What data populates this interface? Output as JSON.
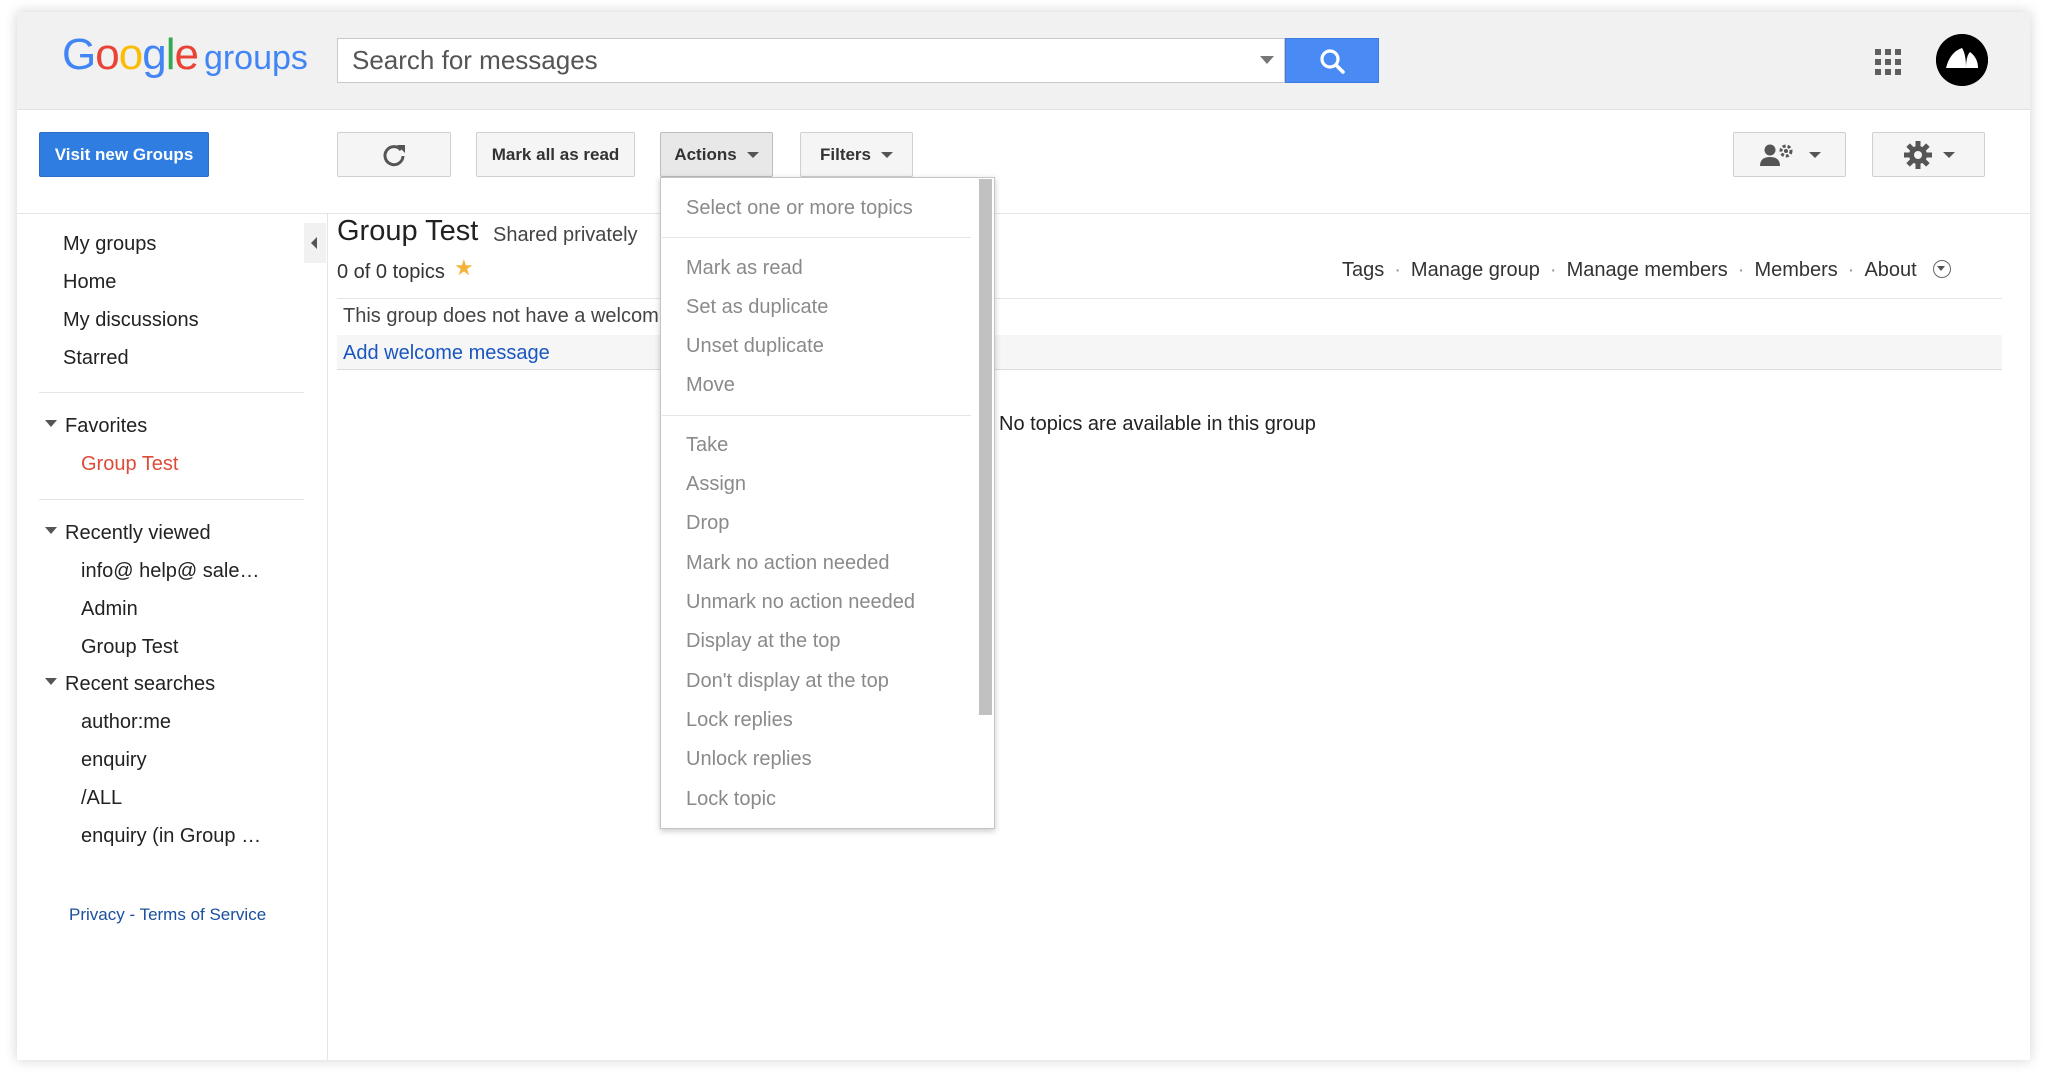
{
  "header": {
    "logo_word": "Google",
    "logo_suffix": "groups",
    "search_placeholder": "Search for messages"
  },
  "toolbar": {
    "visit_new_groups": "Visit new Groups",
    "mark_all_read": "Mark all as read",
    "actions": "Actions",
    "filters": "Filters"
  },
  "sidebar": {
    "nav": [
      "My groups",
      "Home",
      "My discussions",
      "Starred"
    ],
    "favorites": {
      "title": "Favorites",
      "items": [
        "Group Test"
      ]
    },
    "recently_viewed": {
      "title": "Recently viewed",
      "items": [
        "info@ help@ sale…",
        "Admin",
        "Group Test"
      ]
    },
    "recent_searches": {
      "title": "Recent searches",
      "items": [
        "author:me",
        "enquiry",
        "/ALL",
        "enquiry (in Group …"
      ]
    },
    "footer": {
      "privacy": "Privacy",
      "dash": "-",
      "terms": "Terms of Service"
    }
  },
  "main": {
    "group_title": "Group Test",
    "shared": "Shared privately",
    "topics_count": "0 of 0 topics",
    "links": [
      "Tags",
      "Manage group",
      "Manage members",
      "Members",
      "About"
    ],
    "link_separator": "·",
    "welcome_text": "This group does not have a welcom",
    "add_welcome": "Add welcome message",
    "no_topics": "No topics are available in this group"
  },
  "actions_menu": {
    "header": "Select one or more topics",
    "group1": [
      "Mark as read",
      "Set as duplicate",
      "Unset duplicate",
      "Move"
    ],
    "group2": [
      "Take",
      "Assign",
      "Drop",
      "Mark no action needed",
      "Unmark no action needed",
      "Display at the top",
      "Don't display at the top",
      "Lock replies",
      "Unlock replies",
      "Lock topic"
    ]
  },
  "icons": {
    "search": "search-icon",
    "refresh": "refresh-icon",
    "apps": "apps-grid-icon",
    "avatar": "avatar",
    "people_settings": "people-settings-icon",
    "settings": "gear-icon",
    "star": "star-icon"
  },
  "colors": {
    "accent_blue": "#4a8af4",
    "visit_button": "#2f7de1",
    "favorite_red": "#dd4b39",
    "star": "#f3b33d",
    "link_blue": "#1a56c0"
  }
}
